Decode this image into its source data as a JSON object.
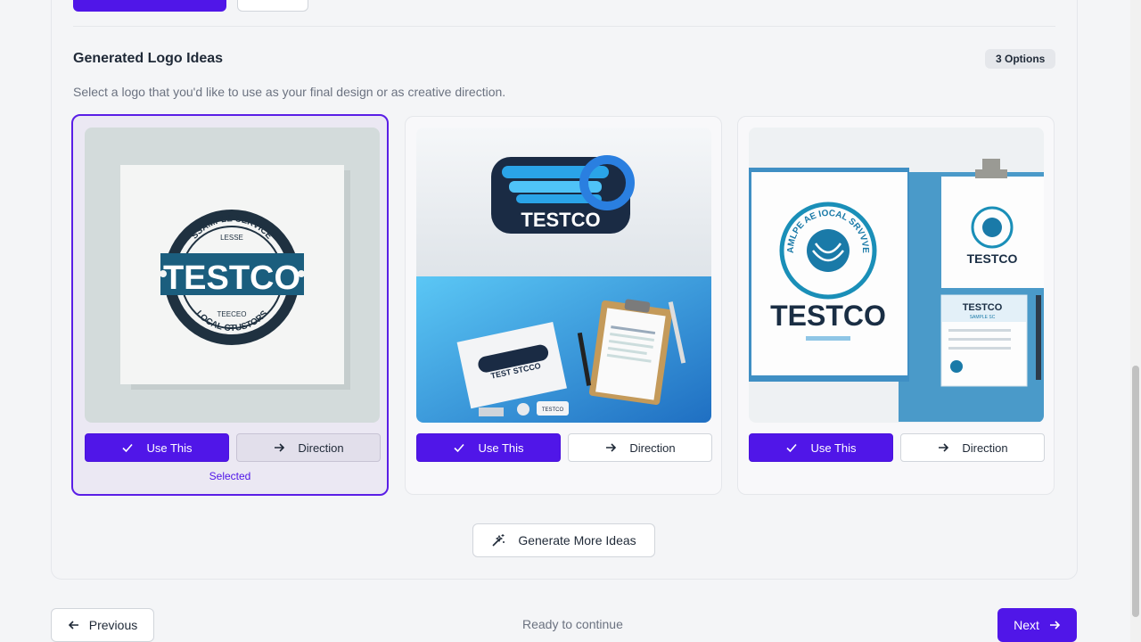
{
  "section": {
    "title": "Generated Logo Ideas",
    "badge": "3 Options",
    "subtitle": "Select a logo that you'd like to use as your final design or as creative direction."
  },
  "cards": [
    {
      "use_label": "Use This",
      "direction_label": "Direction",
      "selected_label": "Selected",
      "logo_text": "TESTCO",
      "arc_top": "SSAMPLE SERVICE",
      "line_top": "LESSE",
      "line_bottom": "TEECEO",
      "arc_bottom": "LOCAL CTUSTORS"
    },
    {
      "use_label": "Use This",
      "direction_label": "Direction",
      "logo_text": "TESTCO",
      "card_text": "TEST STCCO",
      "usb_text": "TESTCO"
    },
    {
      "use_label": "Use This",
      "direction_label": "Direction",
      "logo_text": "TESTCO",
      "arc_text": "SAMLPE AE IOCAL SRVVVEV",
      "clip_text": "TESTCO",
      "doc_text": "TESTCO",
      "doc_sub": "SAMPLE SC"
    }
  ],
  "actions": {
    "generate_more": "Generate More Ideas",
    "previous": "Previous",
    "status": "Ready to continue",
    "next": "Next"
  },
  "colors": {
    "primary": "#5016e8",
    "selected_bg": "#ebe8f3",
    "logo_navy": "#1f3140",
    "logo_teal": "#1b6b8a"
  }
}
